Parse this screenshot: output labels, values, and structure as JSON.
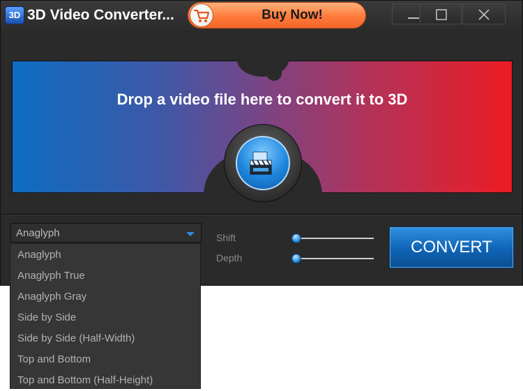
{
  "window": {
    "logo_text": "3D",
    "title": "3D Video Converter...",
    "buy_label": "Buy Now!"
  },
  "drop_area": {
    "text": "Drop a video file here to convert it to 3D",
    "button_icon": "film-clapper-icon"
  },
  "mode": {
    "selected": "Anaglyph",
    "options": [
      "Anaglyph",
      "Anaglyph True",
      "Anaglyph Gray",
      "Side by Side",
      "Side by Side (Half-Width)",
      "Top and Bottom",
      "Top and Bottom (Half-Height)"
    ]
  },
  "sliders": {
    "shift": {
      "label": "Shift",
      "value": 0
    },
    "depth": {
      "label": "Depth",
      "value": 0
    }
  },
  "convert_label": "CONVERT",
  "colors": {
    "accent": "#1e86dd",
    "buy": "#ff7a3a",
    "gradient_left": "#0d6cc2",
    "gradient_right": "#ec1c24"
  },
  "icons": {
    "minimize": "minimize-icon",
    "maximize": "maximize-icon",
    "close": "close-icon",
    "cart": "shopping-cart-icon"
  }
}
